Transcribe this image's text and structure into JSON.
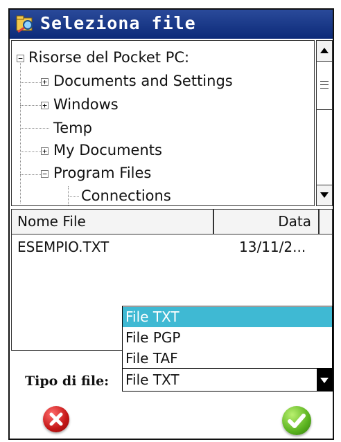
{
  "window": {
    "title": "Seleziona file",
    "app_icon": "folder-search-icon"
  },
  "tree": {
    "items": [
      {
        "label": "Risorse del Pocket PC:",
        "expander": "−"
      },
      {
        "label": "Documents and Settings",
        "expander": "+"
      },
      {
        "label": "Windows",
        "expander": "+"
      },
      {
        "label": "Temp",
        "expander": ""
      },
      {
        "label": "My Documents",
        "expander": "+"
      },
      {
        "label": "Program Files",
        "expander": "−"
      },
      {
        "label": "Connections",
        "expander": ""
      }
    ]
  },
  "file_list": {
    "columns": [
      "Nome File",
      "Data"
    ],
    "rows": [
      {
        "name": "ESEMPIO.TXT",
        "date": "13/11/2..."
      }
    ]
  },
  "file_type": {
    "label": "Tipo di file:",
    "selected": "File TXT",
    "options": [
      "File TXT",
      "File PGP",
      "File TAF"
    ]
  },
  "actions": {
    "cancel_icon": "cancel-x-icon",
    "ok_icon": "confirm-check-icon",
    "cancel_color": "#c31515",
    "ok_color": "#5ab21f"
  }
}
